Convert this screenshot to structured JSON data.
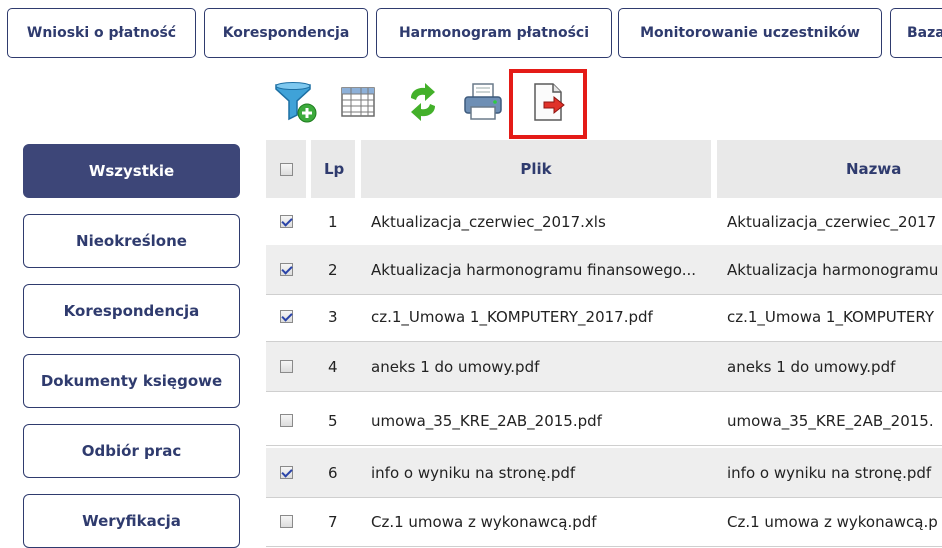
{
  "tabs": [
    {
      "label": "Wnioski o płatność"
    },
    {
      "label": "Korespondencja"
    },
    {
      "label": "Harmonogram płatności"
    },
    {
      "label": "Monitorowanie uczestników"
    },
    {
      "label": "Baza"
    }
  ],
  "toolbar": {
    "icons": [
      "filter-add-icon",
      "table-icon",
      "refresh-icon",
      "print-icon",
      "export-icon"
    ],
    "highlighted": "export-icon",
    "highlight_color": "#e41b17"
  },
  "sidebar": {
    "items": [
      {
        "label": "Wszystkie",
        "active": true
      },
      {
        "label": "Nieokreślone",
        "active": false
      },
      {
        "label": "Korespondencja",
        "active": false
      },
      {
        "label": "Dokumenty księgowe",
        "active": false
      },
      {
        "label": "Odbiór prac",
        "active": false
      },
      {
        "label": "Weryfikacja",
        "active": false
      }
    ],
    "active_color": "#3d4678"
  },
  "table": {
    "columns": {
      "lp": "Lp",
      "plik": "Plik",
      "nazwa": "Nazwa"
    },
    "rows": [
      {
        "checked": true,
        "lp": "1",
        "plik": "Aktualizacja_czerwiec_2017.xls",
        "nazwa": "Aktualizacja_czerwiec_2017"
      },
      {
        "checked": true,
        "lp": "2",
        "plik": "Aktualizacja harmonogramu finansowego...",
        "nazwa": "Aktualizacja harmonogramu"
      },
      {
        "checked": true,
        "lp": "3",
        "plik": "cz.1_Umowa 1_KOMPUTERY_2017.pdf",
        "nazwa": "cz.1_Umowa 1_KOMPUTERY"
      },
      {
        "checked": false,
        "lp": "4",
        "plik": "aneks 1 do umowy.pdf",
        "nazwa": "aneks 1 do umowy.pdf"
      },
      {
        "checked": false,
        "lp": "5",
        "plik": "umowa_35_KRE_2AB_2015.pdf",
        "nazwa": "umowa_35_KRE_2AB_2015."
      },
      {
        "checked": true,
        "lp": "6",
        "plik": "info o wyniku na stronę.pdf",
        "nazwa": "info o wyniku na stronę.pdf"
      },
      {
        "checked": false,
        "lp": "7",
        "plik": "Cz.1 umowa z wykonawcą.pdf",
        "nazwa": "Cz.1 umowa z wykonawcą.p"
      }
    ]
  }
}
